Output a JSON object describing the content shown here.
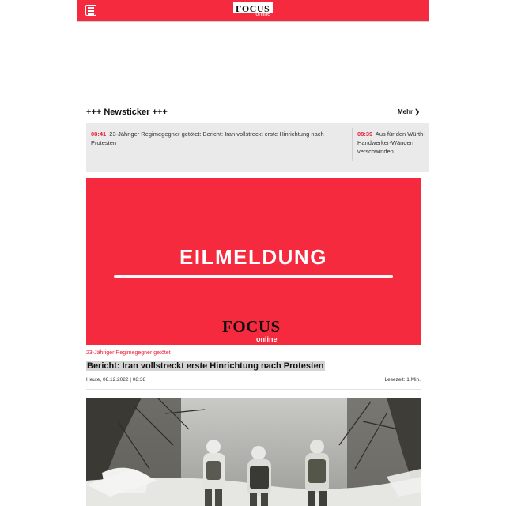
{
  "header": {
    "logo_word": "FOCUS",
    "logo_sub": "online",
    "brand_color": "#f62a3f"
  },
  "newsticker": {
    "title": "+++ Newsticker +++",
    "more_label": "Mehr ❯",
    "items": [
      {
        "time": "08:41",
        "text": "23-Jähriger Regimegegner getötet: Bericht: Iran vollstreckt erste Hinrichtung nach Protesten"
      },
      {
        "time": "08:39",
        "text": "Aus für den Würth-Handwerker-Wänden verschwinden"
      }
    ]
  },
  "article": {
    "banner_text": "EILMELDUNG",
    "banner_logo_word": "FOCUS",
    "banner_logo_sub": "online",
    "kicker": "23-Jähriger Regimegegner getötet",
    "headline": "Bericht: Iran vollstreckt erste Hinrichtung nach Protesten",
    "date": "Heute, 08.12.2022 | 08:38",
    "read_time": "Lesezeit: 1 Min."
  },
  "next_article": {
    "image": "photo-soldiers-snow"
  }
}
